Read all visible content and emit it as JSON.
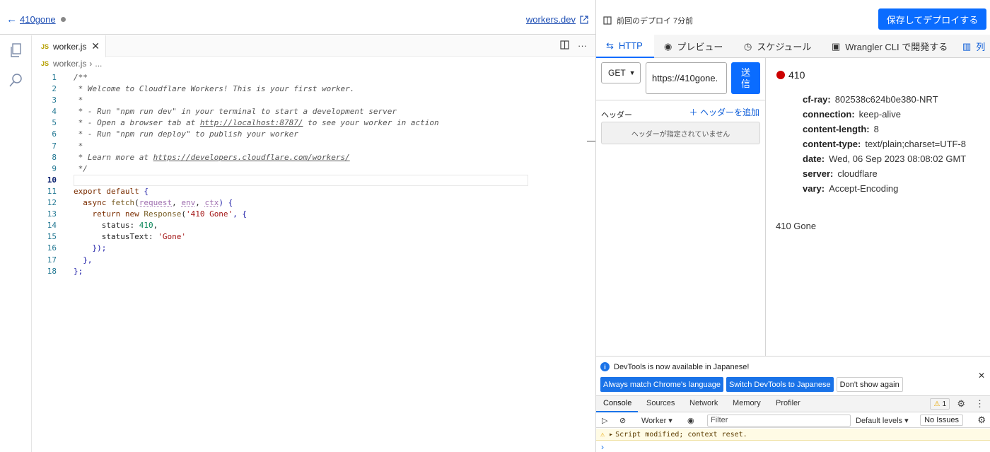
{
  "left": {
    "back_label": "410gone",
    "workers_link": "workers.dev",
    "tab_file": "worker.js",
    "tab_badge": "JS",
    "breadcrumb_file": "worker.js",
    "breadcrumb_more": "...",
    "code_lines": [
      {
        "n": "1"
      },
      {
        "n": "2"
      },
      {
        "n": "3"
      },
      {
        "n": "4"
      },
      {
        "n": "5"
      },
      {
        "n": "6"
      },
      {
        "n": "7"
      },
      {
        "n": "8"
      },
      {
        "n": "9"
      },
      {
        "n": "10"
      },
      {
        "n": "11"
      },
      {
        "n": "12"
      },
      {
        "n": "13"
      },
      {
        "n": "14"
      },
      {
        "n": "15"
      },
      {
        "n": "16"
      },
      {
        "n": "17"
      },
      {
        "n": "18"
      }
    ],
    "code": {
      "l1": "/**",
      "l2": " * Welcome to Cloudflare Workers! This is your first worker.",
      "l3": " *",
      "l4": " * - Run \"npm run dev\" in your terminal to start a development server",
      "l5a": " * - Open a browser tab at ",
      "l5b": "http://localhost:8787/",
      "l5c": " to see your worker in action",
      "l6": " * - Run \"npm run deploy\" to publish your worker",
      "l7": " *",
      "l8a": " * Learn more at ",
      "l8b": "https://developers.cloudflare.com/workers/",
      "l9": " */",
      "l11a": "export default",
      "l11b": " {",
      "l12a": "  async ",
      "l12b": "fetch",
      "l12c": "(",
      "l12d": "request",
      "l12e": ", ",
      "l12f": "env",
      "l12g": ", ",
      "l12h": "ctx",
      "l12i": ") {",
      "l13a": "    return new ",
      "l13b": "Response",
      "l13c": "(",
      "l13d": "'410 Gone'",
      "l13e": ", {",
      "l14a": "      status: ",
      "l14b": "410",
      "l14c": ",",
      "l15a": "      statusText: ",
      "l15b": "'Gone'",
      "l16": "    });",
      "l17": "  },",
      "l18": "};"
    }
  },
  "right": {
    "deploy_info": "前回のデプロイ 7分前",
    "deploy_button": "保存してデプロイする",
    "tabs": {
      "http": "HTTP",
      "preview": "プレビュー",
      "schedule": "スケジュール",
      "wrangler": "Wrangler CLI で開発する",
      "cols": "列"
    },
    "method": "GET",
    "url": "https://410gone.",
    "send": "送信",
    "headers_label": "ヘッダー",
    "add_header": "ヘッダーを追加",
    "no_headers": "ヘッダーが指定されていません",
    "status_code": "410",
    "status_color": "#cc0000",
    "response_headers": [
      {
        "k": "cf-ray:",
        "v": "802538c624b0e380-NRT"
      },
      {
        "k": "connection:",
        "v": "keep-alive"
      },
      {
        "k": "content-length:",
        "v": "8"
      },
      {
        "k": "content-type:",
        "v": "text/plain;charset=UTF-8"
      },
      {
        "k": "date:",
        "v": "Wed, 06 Sep 2023 08:08:02 GMT"
      },
      {
        "k": "server:",
        "v": "cloudflare"
      },
      {
        "k": "vary:",
        "v": "Accept-Encoding"
      }
    ],
    "body": "410 Gone"
  },
  "devtools": {
    "notice": "DevTools is now available in Japanese!",
    "btn_match": "Always match Chrome's language",
    "btn_switch": "Switch DevTools to Japanese",
    "btn_dont": "Don't show again",
    "tabs": [
      "Console",
      "Sources",
      "Network",
      "Memory",
      "Profiler"
    ],
    "warn_count": "1",
    "context": "Worker",
    "filter_placeholder": "Filter",
    "levels": "Default levels",
    "issues": "No Issues",
    "warning_msg": "Script modified; context reset.",
    "accent": "#1a73e8"
  }
}
